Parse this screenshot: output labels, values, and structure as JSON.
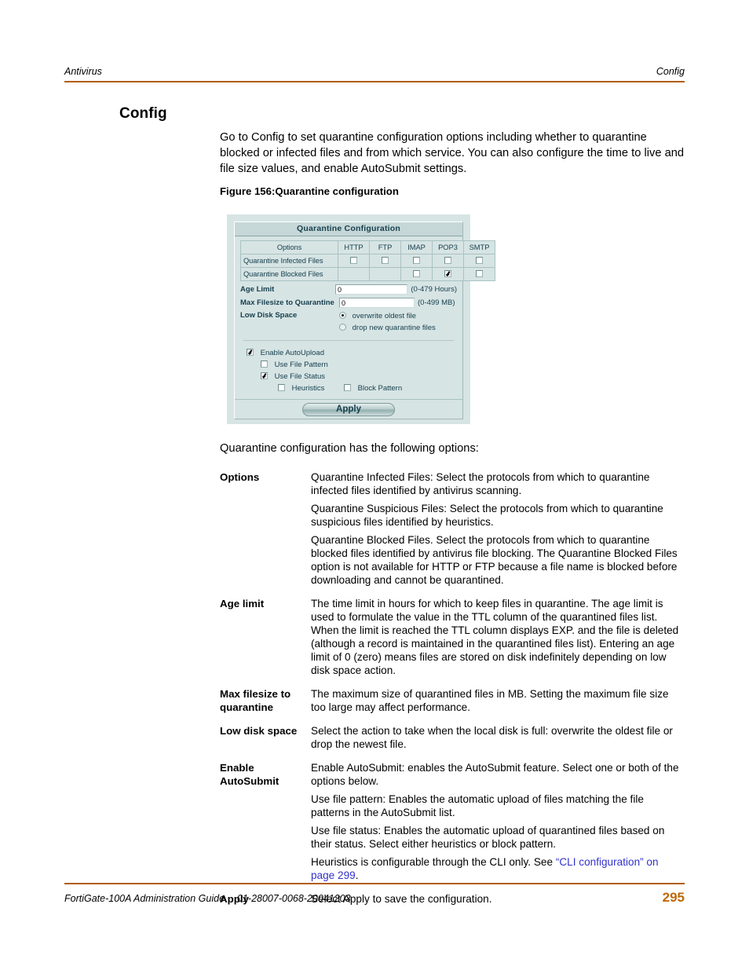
{
  "header": {
    "left": "Antivirus",
    "right": "Config"
  },
  "heading": "Config",
  "intro_paragraph": "Go to Config to set quarantine configuration options including whether to quarantine blocked or infected files and from which service. You can also configure the time to live and file size values, and enable AutoSubmit settings.",
  "figure_caption": "Figure 156:Quarantine configuration",
  "figure": {
    "title": "Quarantine Configuration",
    "table": {
      "headers": [
        "Options",
        "HTTP",
        "FTP",
        "IMAP",
        "POP3",
        "SMTP"
      ],
      "rows": [
        {
          "label": "Quarantine Infected Files",
          "cells": [
            {
              "type": "checkbox",
              "checked": false
            },
            {
              "type": "checkbox",
              "checked": false
            },
            {
              "type": "checkbox",
              "checked": false
            },
            {
              "type": "checkbox",
              "checked": false
            },
            {
              "type": "checkbox",
              "checked": false
            }
          ]
        },
        {
          "label": "Quarantine Blocked Files",
          "cells": [
            {
              "type": "empty"
            },
            {
              "type": "empty"
            },
            {
              "type": "checkbox",
              "checked": false
            },
            {
              "type": "checkbox",
              "checked": true
            },
            {
              "type": "checkbox",
              "checked": false
            }
          ]
        }
      ]
    },
    "age_limit": {
      "label": "Age Limit",
      "value": "0",
      "hint": "(0-479 Hours)"
    },
    "max_filesize": {
      "label": "Max Filesize to Quarantine",
      "value": "0",
      "hint": "(0-499 MB)"
    },
    "low_disk_space": {
      "label": "Low Disk Space",
      "options": [
        {
          "label": "overwrite oldest file",
          "selected": true
        },
        {
          "label": "drop new quarantine files",
          "selected": false
        }
      ]
    },
    "autoupload": [
      {
        "label": "Enable AutoUpload",
        "checked": true,
        "level": 1
      },
      {
        "label": "Use File Pattern",
        "checked": false,
        "level": 2
      },
      {
        "label": "Use File Status",
        "checked": true,
        "level": 2
      },
      {
        "label": "Heuristics",
        "checked": false,
        "level": 3
      },
      {
        "label": "Block Pattern",
        "checked": false,
        "level": 3
      }
    ],
    "apply_label": "Apply",
    "colors": {
      "panel_bg": "#d7e4e4",
      "title_bg": "#c6d7d7",
      "text": "#17414f",
      "border": "#a9c2c2"
    }
  },
  "intro_options_line": "Quarantine configuration has the following options:",
  "definitions": [
    {
      "term": "Options",
      "paragraphs": [
        "Quarantine Infected Files: Select the protocols from which to quarantine infected files identified by antivirus scanning.",
        "Quarantine Suspicious Files: Select the protocols from which to quarantine suspicious files identified by heuristics.",
        "Quarantine Blocked Files. Select the protocols from which to quarantine blocked files identified by antivirus file blocking. The Quarantine Blocked Files option is not available for HTTP or FTP because a file name is blocked before downloading and cannot be quarantined."
      ]
    },
    {
      "term": "Age limit",
      "paragraphs": [
        "The time limit in hours for which to keep files in quarantine. The age limit is used to formulate the value in the TTL column of the quarantined files list. When the limit is reached the TTL column displays EXP. and the file is deleted (although a record is maintained in the quarantined files list). Entering an age limit of 0 (zero) means files are stored on disk indefinitely depending on low disk space action."
      ]
    },
    {
      "term": "Max filesize to quarantine",
      "paragraphs": [
        "The maximum size of quarantined files in MB. Setting the maximum file size too large may affect performance."
      ]
    },
    {
      "term": "Low disk space",
      "paragraphs": [
        "Select the action to take when the local disk is full: overwrite the oldest file or drop the newest file."
      ]
    },
    {
      "term": "Enable AutoSubmit",
      "paragraphs": [
        "Enable AutoSubmit: enables the AutoSubmit feature. Select one or both of the options below.",
        "Use file pattern: Enables the automatic upload of files matching the file patterns in the AutoSubmit list.",
        "Use file status: Enables the automatic upload of quarantined files based on their status. Select either heuristics or block pattern."
      ],
      "link_paragraph": {
        "before": "Heuristics is configurable through the CLI only. See ",
        "link": "“CLI configuration” on page 299",
        "after": "."
      }
    },
    {
      "term": "Apply",
      "paragraphs": [
        "Select Apply to save the configuration."
      ]
    }
  ],
  "footer": {
    "guide": "FortiGate-100A Administration Guide",
    "docnum": "01-28007-0068-20041203",
    "page": "295"
  },
  "accent_color": "#b05e07",
  "link_color": "#3232cd"
}
